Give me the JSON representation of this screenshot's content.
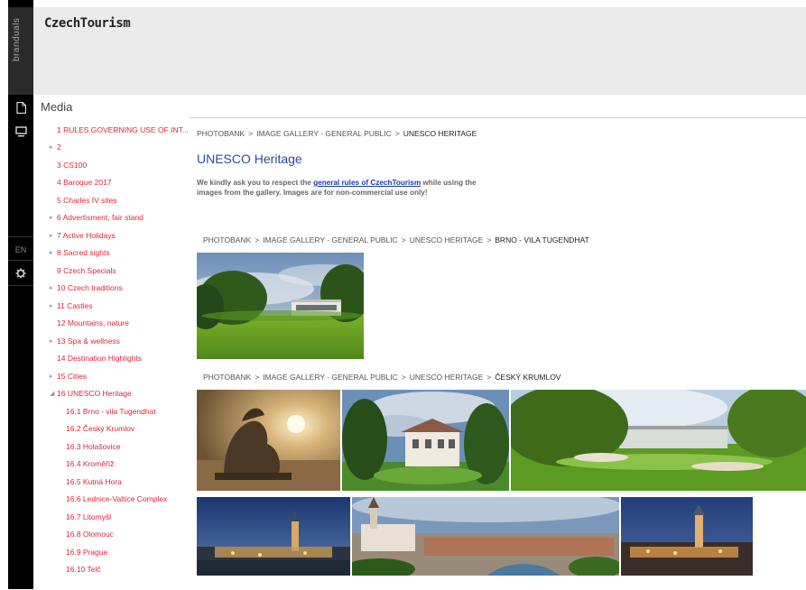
{
  "rail": {
    "brand": "branduals",
    "lang": "EN",
    "icons": [
      "document-icon",
      "monitor-icon",
      "gear-icon"
    ]
  },
  "header": {
    "logo": "CzechTourism"
  },
  "media_title": "Media",
  "sidebar": {
    "items": [
      {
        "label": "1 RULES GOVERNING USE OF INT...",
        "level": 0,
        "arrow": ""
      },
      {
        "label": "2",
        "level": 0,
        "arrow": "▸"
      },
      {
        "label": "3 CS100",
        "level": 0,
        "arrow": ""
      },
      {
        "label": "4 Baroque 2017",
        "level": 0,
        "arrow": ""
      },
      {
        "label": "5 Charles IV sites",
        "level": 0,
        "arrow": ""
      },
      {
        "label": "6 Advertisment, fair stand",
        "level": 0,
        "arrow": "▸"
      },
      {
        "label": "7 Active Holidays",
        "level": 0,
        "arrow": "▸"
      },
      {
        "label": "8 Sacred sights",
        "level": 0,
        "arrow": "▸"
      },
      {
        "label": "9 Czech Specials",
        "level": 0,
        "arrow": ""
      },
      {
        "label": "10 Czech traditions",
        "level": 0,
        "arrow": "▸"
      },
      {
        "label": "11 Castles",
        "level": 0,
        "arrow": "▸"
      },
      {
        "label": "12 Mountains, nature",
        "level": 0,
        "arrow": ""
      },
      {
        "label": "13 Spa & wellness",
        "level": 0,
        "arrow": "▸"
      },
      {
        "label": "14 Destination Highlights",
        "level": 0,
        "arrow": ""
      },
      {
        "label": "15 Cities",
        "level": 0,
        "arrow": "▸"
      },
      {
        "label": "16 UNESCO Heritage",
        "level": 0,
        "arrow": "◢"
      },
      {
        "label": "16.1 Brno - vila Tugendhat",
        "level": 1,
        "arrow": ""
      },
      {
        "label": "16.2 Český Krumlov",
        "level": 1,
        "arrow": ""
      },
      {
        "label": "16.3 Holašovice",
        "level": 1,
        "arrow": ""
      },
      {
        "label": "16.4 Kroměříž",
        "level": 1,
        "arrow": ""
      },
      {
        "label": "16.5 Kutná Hora",
        "level": 1,
        "arrow": ""
      },
      {
        "label": "16.6 Lednice-Valtice Complex",
        "level": 1,
        "arrow": ""
      },
      {
        "label": "16.7 Litomyšl",
        "level": 1,
        "arrow": ""
      },
      {
        "label": "16.8 Olomouc",
        "level": 1,
        "arrow": ""
      },
      {
        "label": "16.9 Prague",
        "level": 1,
        "arrow": ""
      },
      {
        "label": "16.10 Telč",
        "level": 1,
        "arrow": ""
      }
    ]
  },
  "content": {
    "breadcrumb": [
      "PHOTOBANK",
      "IMAGE GALLERY - GENERAL PUBLIC",
      "UNESCO HERITAGE"
    ],
    "title": "UNESCO Heritage",
    "notice_before": "We kindly ask you to respect the ",
    "notice_link": "general rules of CzechTourism",
    "notice_after": " while using the images from the gallery. Images are for non-commercial use only!",
    "sections": [
      {
        "breadcrumb": [
          "PHOTOBANK",
          "IMAGE GALLERY - GENERAL PUBLIC",
          "UNESCO HERITAGE",
          "BRNO - VILA TUGENDHAT"
        ]
      },
      {
        "breadcrumb": [
          "PHOTOBANK",
          "IMAGE GALLERY - GENERAL PUBLIC",
          "UNESCO HERITAGE",
          "ČESKÝ KRUMLOV"
        ]
      }
    ]
  },
  "colors": {
    "accent_red": "#d9263b",
    "title_blue": "#2a4a9a",
    "link_blue": "#1a3aa8",
    "rail_black": "#000000",
    "header_gray": "#ebebeb"
  }
}
